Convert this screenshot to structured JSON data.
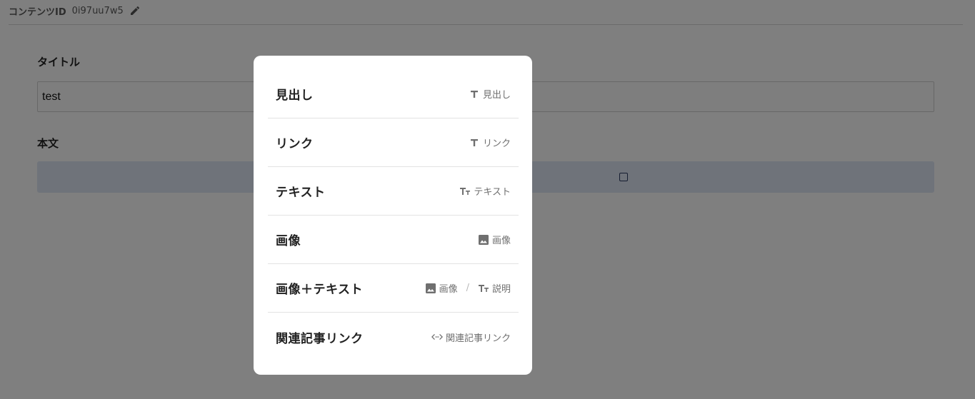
{
  "content_id": {
    "label": "コンテンツID",
    "value": "0i97uu7w5",
    "edit_icon": "pencil-icon"
  },
  "fields": {
    "title_label": "タイトル",
    "title_value": "test",
    "body_label": "本文"
  },
  "modal": {
    "options": [
      {
        "title": "見出し",
        "meta": [
          {
            "icon": "text-icon",
            "label": "見出し"
          }
        ]
      },
      {
        "title": "リンク",
        "meta": [
          {
            "icon": "text-icon",
            "label": "リンク"
          }
        ]
      },
      {
        "title": "テキスト",
        "meta": [
          {
            "icon": "text-size-icon",
            "label": "テキスト"
          }
        ]
      },
      {
        "title": "画像",
        "meta": [
          {
            "icon": "image-icon",
            "label": "画像"
          }
        ]
      },
      {
        "title": "画像＋テキスト",
        "meta": [
          {
            "icon": "image-icon",
            "label": "画像"
          },
          {
            "icon": "text-size-icon",
            "label": "説明"
          }
        ],
        "separator": "/"
      },
      {
        "title": "関連記事リンク",
        "meta": [
          {
            "icon": "code-icon",
            "label": "関連記事リンク"
          }
        ]
      }
    ]
  },
  "colors": {
    "overlay": "rgba(0,0,0,0.5)",
    "add_block_bar": "#dfe6f4"
  }
}
